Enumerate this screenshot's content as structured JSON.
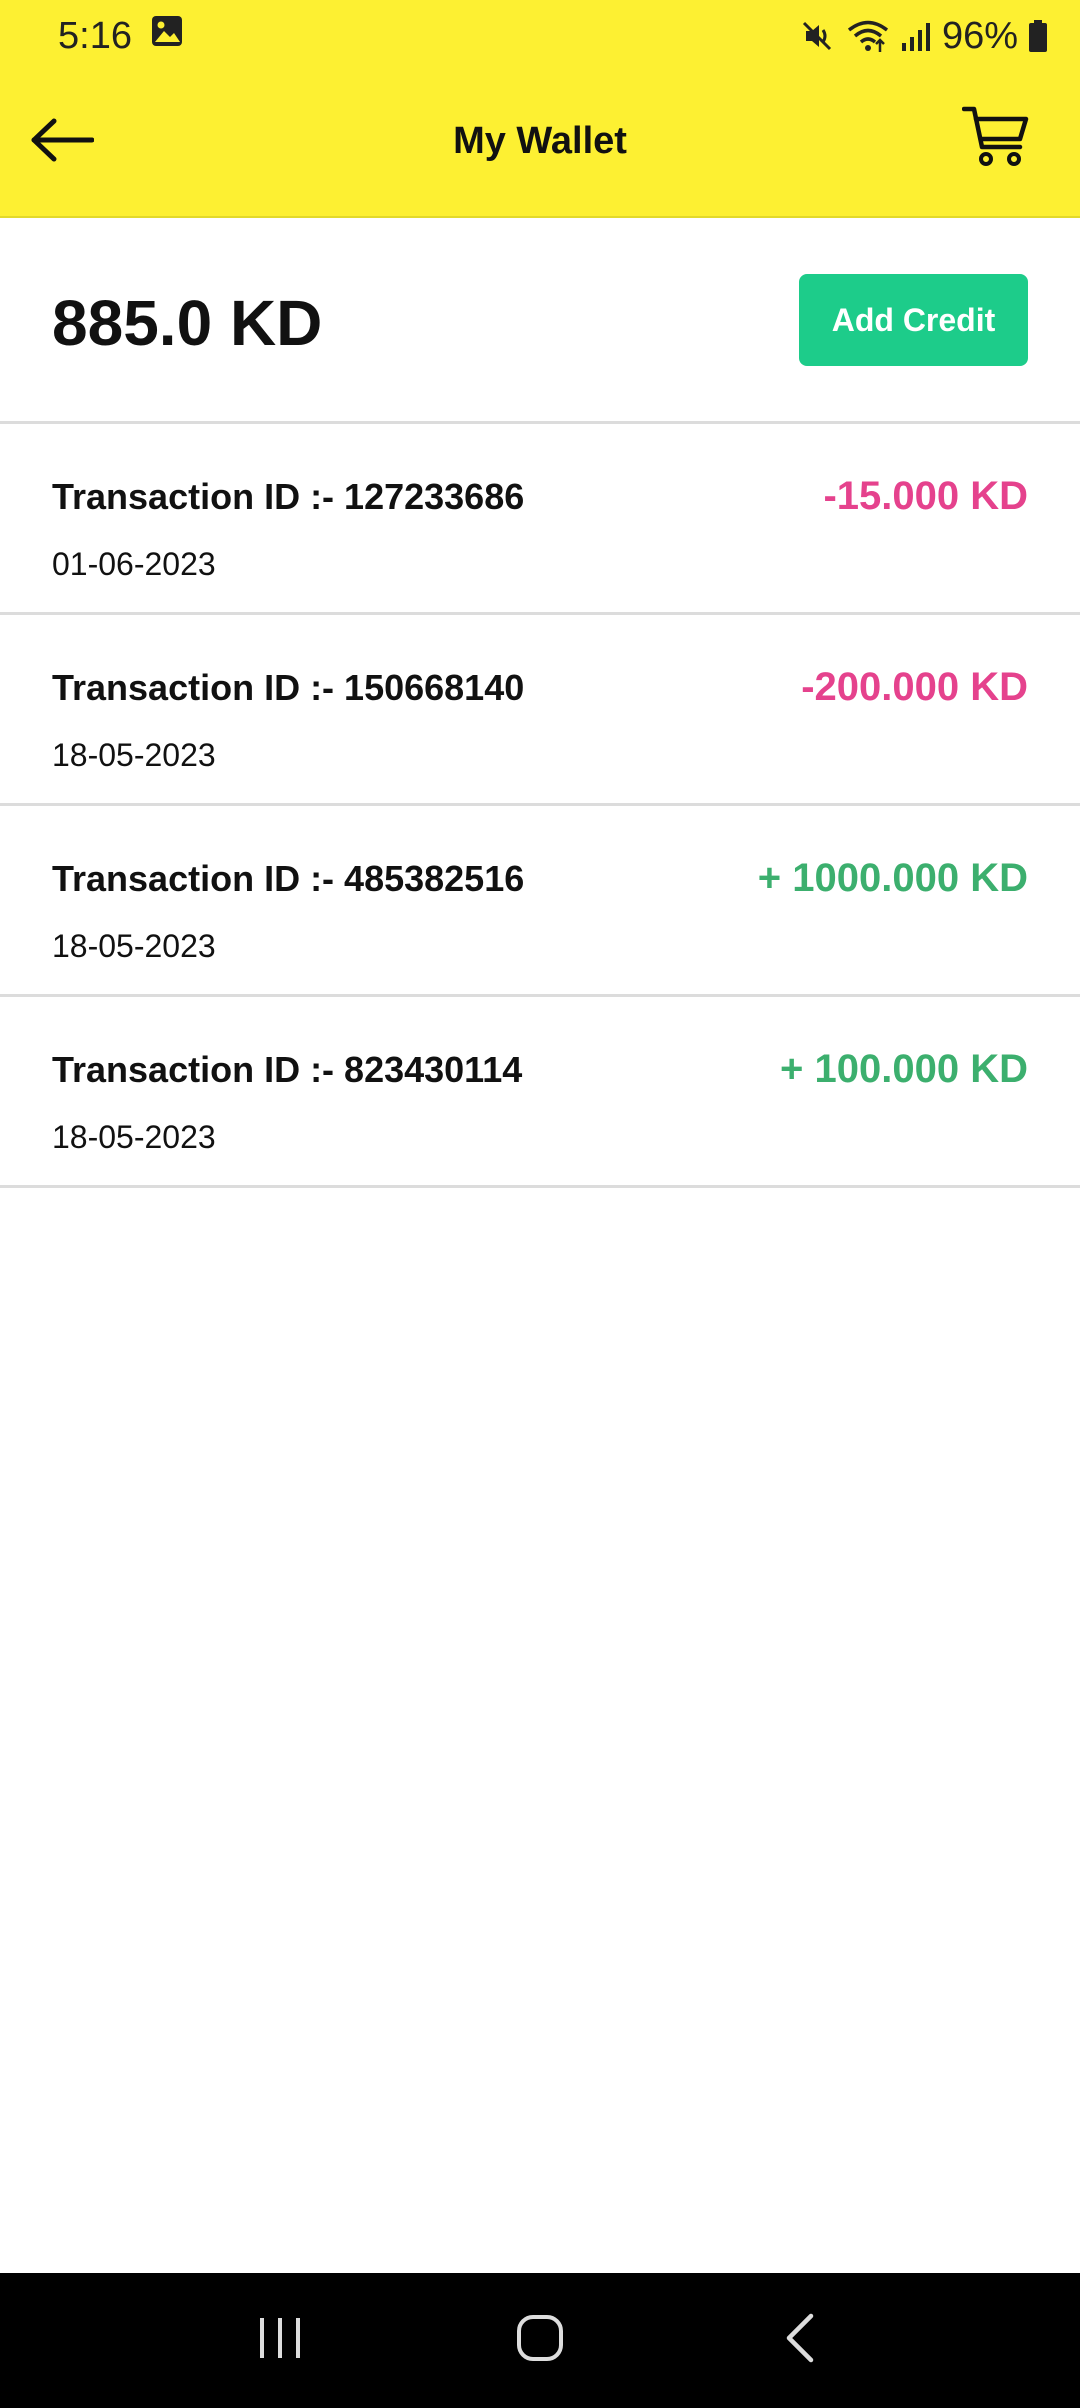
{
  "status_bar": {
    "time": "5:16",
    "battery": "96%"
  },
  "app_bar": {
    "title": "My Wallet"
  },
  "wallet": {
    "balance": "885.0 KD",
    "add_credit_label": "Add Credit"
  },
  "transactions": [
    {
      "id_label": "Transaction ID :- 127233686",
      "date": "01-06-2023",
      "amount": "-15.000 KD",
      "type": "debit"
    },
    {
      "id_label": "Transaction ID :- 150668140",
      "date": "18-05-2023",
      "amount": "-200.000 KD",
      "type": "debit"
    },
    {
      "id_label": "Transaction ID :- 485382516",
      "date": "18-05-2023",
      "amount": "+ 1000.000 KD",
      "type": "credit"
    },
    {
      "id_label": "Transaction ID :- 823430114",
      "date": "18-05-2023",
      "amount": "+ 100.000 KD",
      "type": "credit"
    }
  ],
  "colors": {
    "header_bg": "#fdf032",
    "accent_button": "#1dcc8a",
    "debit": "#e5428d",
    "credit": "#3caf6e"
  },
  "icons": {
    "back": "arrow-left-icon",
    "cart": "cart-icon",
    "gallery": "image-icon",
    "mute": "mute-icon",
    "wifi": "wifi-icon",
    "signal": "signal-icon",
    "battery": "battery-icon",
    "nav_recents": "recents-icon",
    "nav_home": "home-icon",
    "nav_back": "back-chevron-icon"
  }
}
